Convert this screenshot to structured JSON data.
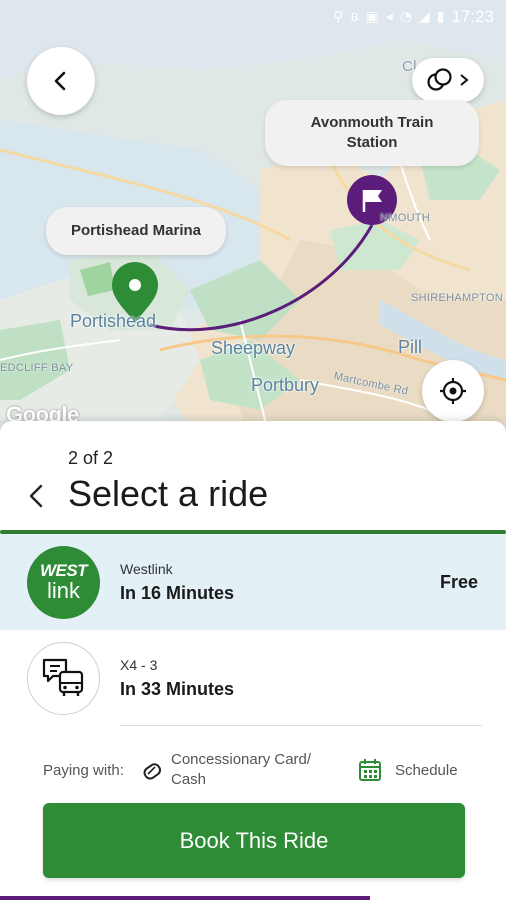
{
  "status_bar": {
    "time": "17:23"
  },
  "map": {
    "origin_callout": "Portishead Marina",
    "destination_callout": "Avonmouth Train Station",
    "places": {
      "portishead": "Portishead",
      "sheepway": "Sheepway",
      "portbury": "Portbury",
      "pill": "Pill",
      "shirehampton": "SHIREHAMPTON",
      "avonmouth": "NMOUTH",
      "redcliff_bay": "EDCLIFF BAY",
      "martcombe": "Martcombe Rd",
      "top_right": "Cl     g"
    },
    "attribution": "Google",
    "colors": {
      "route": "#5c1d7a",
      "origin_pin": "#2e8b36",
      "dest_pin": "#5c1d7a"
    }
  },
  "sheet": {
    "step": "2 of 2",
    "title": "Select a ride",
    "rides": [
      {
        "logo_line1": "WEST",
        "logo_line2": "link",
        "name": "Westlink",
        "eta": "In 16 Minutes",
        "price": "Free"
      },
      {
        "name": "X4 - 3",
        "eta": "In 33 Minutes",
        "price": ""
      }
    ],
    "payment": {
      "label": "Paying with:",
      "method": "Concessionary Card/ Cash",
      "schedule": "Schedule"
    },
    "book_button": "Book This Ride"
  },
  "icons": [
    "back-arrow-icon",
    "layers-icon",
    "chevron-right-icon",
    "locate-icon",
    "flag-icon",
    "map-pin-icon",
    "bus-chat-icon",
    "card-icon",
    "calendar-icon"
  ]
}
